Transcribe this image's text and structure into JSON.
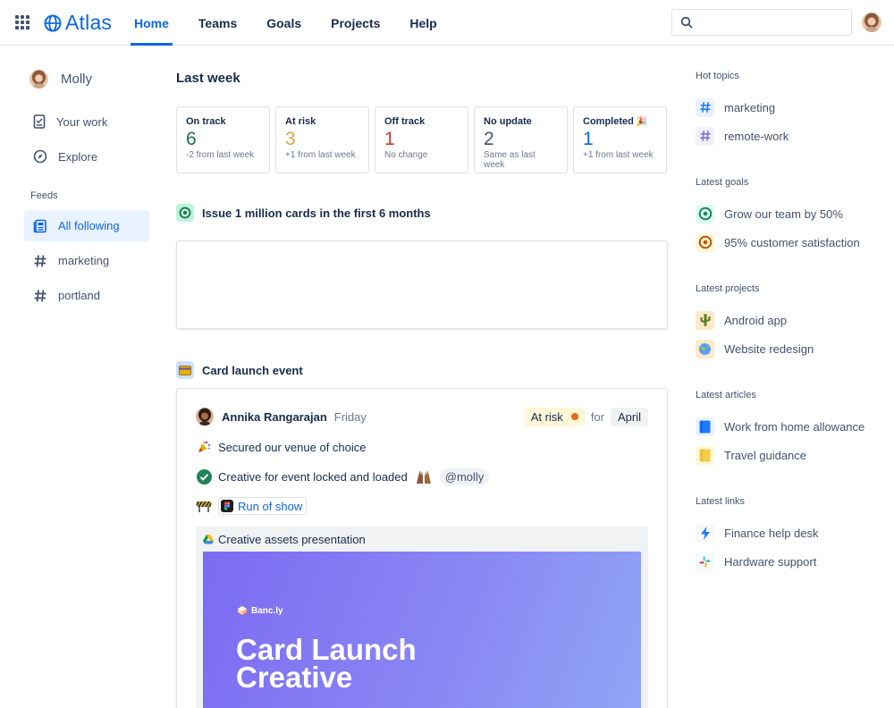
{
  "app": {
    "name": "Atlas"
  },
  "nav": {
    "items": [
      {
        "label": "Home",
        "active": true
      },
      {
        "label": "Teams",
        "active": false
      },
      {
        "label": "Goals",
        "active": false
      },
      {
        "label": "Projects",
        "active": false
      },
      {
        "label": "Help",
        "active": false
      }
    ]
  },
  "search": {
    "placeholder": "",
    "value": ""
  },
  "sidebar": {
    "user_name": "Molly",
    "links": [
      {
        "label": "Your work",
        "icon": "document-icon"
      },
      {
        "label": "Explore",
        "icon": "compass-icon"
      }
    ],
    "feeds_label": "Feeds",
    "feeds": [
      {
        "label": "All following",
        "icon": "feed-icon",
        "active": true
      },
      {
        "label": "marketing",
        "icon": "hashtag-icon",
        "active": false
      },
      {
        "label": "portland",
        "icon": "hashtag-icon",
        "active": false
      }
    ]
  },
  "main": {
    "section_title": "Last week",
    "stats": [
      {
        "label": "On track",
        "value": "6",
        "sub": "-2 from last week",
        "color": "#216e4e"
      },
      {
        "label": "At risk",
        "value": "3",
        "sub": "+1 from last week",
        "color": "#e2a03f"
      },
      {
        "label": "Off track",
        "value": "1",
        "sub": "No change",
        "color": "#c9372c"
      },
      {
        "label": "No update",
        "value": "2",
        "sub": "Same as last week",
        "color": "#44546f"
      },
      {
        "label": "Completed",
        "value": "1",
        "sub": "+1 from last week",
        "color": "#0c66e4"
      }
    ],
    "goal": {
      "title": "Issue 1 million cards in the first 6 months"
    },
    "project": {
      "title": "Card launch event",
      "update": {
        "author": "Annika Rangarajan",
        "date": "Friday",
        "status": "At risk",
        "for_text": "for",
        "month": "April",
        "lines": [
          {
            "text": "Secured our venue of choice",
            "emoji": "party-popper-icon"
          },
          {
            "text": "Creative for event locked and loaded",
            "emoji": "check-icon",
            "mention": "@molly"
          },
          {
            "link": "Run of show",
            "emoji": "construction-icon"
          }
        ],
        "embed": {
          "title": "Creative assets presentation",
          "brand": "Banc.ly",
          "slide_title_line1": "Card Launch",
          "slide_title_line2": "Creative"
        }
      }
    }
  },
  "right": {
    "hot_topics": {
      "title": "Hot topics",
      "items": [
        "marketing",
        "remote-work"
      ]
    },
    "latest_goals": {
      "title": "Latest goals",
      "items": [
        "Grow our team by 50%",
        "95% customer satisfaction"
      ]
    },
    "latest_projects": {
      "title": "Latest projects",
      "items": [
        "Android app",
        "Website redesign"
      ]
    },
    "latest_articles": {
      "title": "Latest articles",
      "items": [
        "Work from home allowance",
        "Travel guidance"
      ]
    },
    "latest_links": {
      "title": "Latest links",
      "items": [
        "Finance help desk",
        "Hardware support"
      ]
    }
  }
}
